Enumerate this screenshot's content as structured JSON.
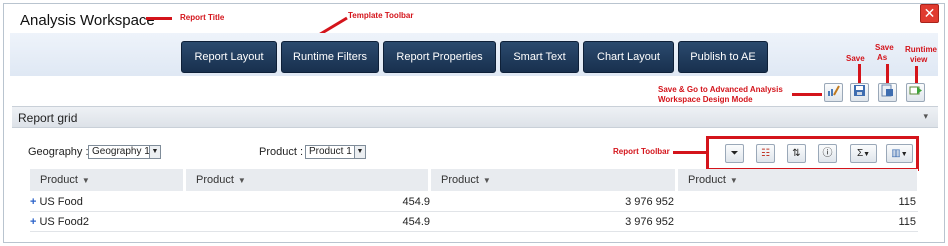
{
  "window": {
    "title": "Analysis Workspace",
    "close_glyph": "✕"
  },
  "annotations": {
    "report_title": "Report Title",
    "template_toolbar": "Template Toolbar",
    "save": "Save",
    "save_as_line1": "Save",
    "save_as_line2": "As",
    "runtime_line1": "Runtime",
    "runtime_line2": "view",
    "advanced_line1": "Save & Go to Advanced Analysis",
    "advanced_line2": "Workspace Design Mode",
    "report_toolbar": "Report Toolbar"
  },
  "template_toolbar": {
    "buttons": [
      {
        "label": "Report Layout"
      },
      {
        "label": "Runtime Filters"
      },
      {
        "label": "Report Properties"
      },
      {
        "label": "Smart Text"
      },
      {
        "label": "Chart Layout"
      },
      {
        "label": "Publish to AE"
      }
    ]
  },
  "action_icons": {
    "advanced": "pencil-chart-icon",
    "save": "save-icon",
    "save_as": "save-as-icon",
    "runtime": "runtime-view-icon"
  },
  "report_grid": {
    "title": "Report grid",
    "collapse_glyph": "▾",
    "filters": [
      {
        "label": "Geography :",
        "value": "Geography 1"
      },
      {
        "label": "Product :",
        "value": "Product 1"
      }
    ],
    "report_toolbar": {
      "buttons": [
        "filter-icon",
        "columns-icon",
        "sort-icon",
        "info-icon",
        "sum-dropdown",
        "chart-dropdown"
      ],
      "glyphs": {
        "filter": "⏷",
        "columns": "☷",
        "sort": "⇅",
        "info": "ⓘ",
        "sum": "Σ",
        "chart": "▥"
      }
    },
    "columns": [
      {
        "label": "Product"
      },
      {
        "label": "Product"
      },
      {
        "label": "Product"
      },
      {
        "label": "Product"
      }
    ],
    "sort_glyph": "▼",
    "rows": [
      {
        "expand": "+",
        "name": "US Food",
        "v1": "454.9",
        "v2": "3 976 952",
        "v3": "115"
      },
      {
        "expand": "+",
        "name": "US Food2",
        "v1": "454.9",
        "v2": "3 976 952",
        "v3": "115"
      }
    ]
  },
  "colors": {
    "annotation_red": "#d4141b",
    "toolbar_button_navy": "#1f3a5c",
    "close_red": "#e03a2f"
  }
}
